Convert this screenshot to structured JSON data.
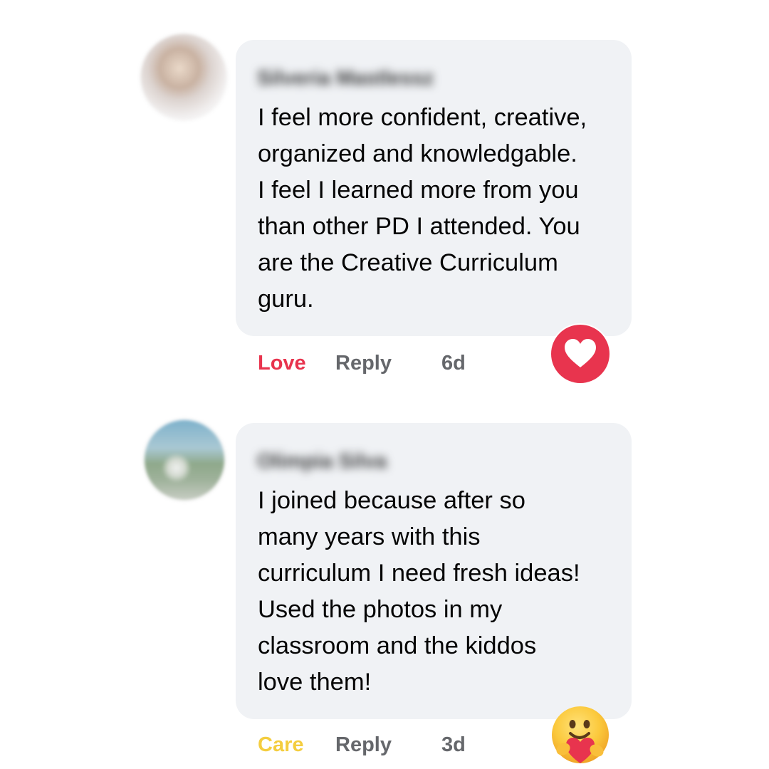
{
  "comments": [
    {
      "author": "Silveria Mastlessz",
      "text_lines": [
        "I feel more confident, creative,",
        "organized and knowledgable.",
        "I feel I learned more from you",
        "than other PD I attended. You",
        "are the Creative Curriculum",
        "guru."
      ],
      "reaction_label": "Love",
      "reply_label": "Reply",
      "time": "6d",
      "reaction_icon": "love-heart-icon",
      "reaction_color": "#e8344e"
    },
    {
      "author": "Olimpia Silva",
      "text_lines": [
        "I joined because after so",
        "many years with this",
        "curriculum I need fresh ideas!",
        "Used the photos in my",
        "classroom and the kiddos",
        "love them!"
      ],
      "reaction_label": "Care",
      "reply_label": "Reply",
      "time": "3d",
      "reaction_icon": "care-emoji-icon",
      "reaction_color": "#f4cd3f"
    }
  ],
  "colors": {
    "bubble_background": "#f0f2f5",
    "secondary_text": "#65676b",
    "love": "#e8344e",
    "care": "#f4cd3f"
  }
}
